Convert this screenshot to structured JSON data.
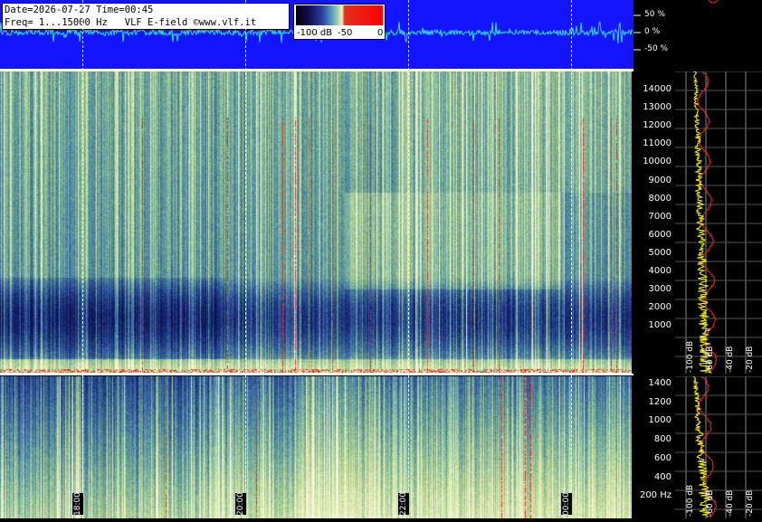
{
  "header": {
    "line1": "Date=2026-07-27 Time=00:45",
    "line2": "Freq= 1...15000 Hz   VLF E-field ©www.vlf.it"
  },
  "colorbar": {
    "min_label": "-100 dB",
    "mid_label": "-50",
    "max_label": "0"
  },
  "amplitude_scale": [
    "50 %",
    "0 %",
    "-50 %"
  ],
  "freq_axis_high": [
    "14000",
    "13000",
    "12000",
    "11000",
    "10000",
    "9000",
    "8000",
    "7000",
    "6000",
    "5000",
    "4000",
    "3000",
    "2000",
    "1000"
  ],
  "freq_axis_low": [
    "1400",
    "1200",
    "1000",
    "800",
    "600",
    "400",
    "200 Hz"
  ],
  "db_labels": [
    "-100 dB",
    "-80 dB",
    "-60 dB",
    "-40 dB",
    "-20 dB"
  ],
  "time_labels": [
    "18:00",
    "20:00",
    "22:00",
    "00:00"
  ],
  "colors": {
    "waveform_bg": "#1414ff",
    "trace_yellow": "#ffff00",
    "trace_red": "#ff2020",
    "trace_green": "#40ff40"
  }
}
